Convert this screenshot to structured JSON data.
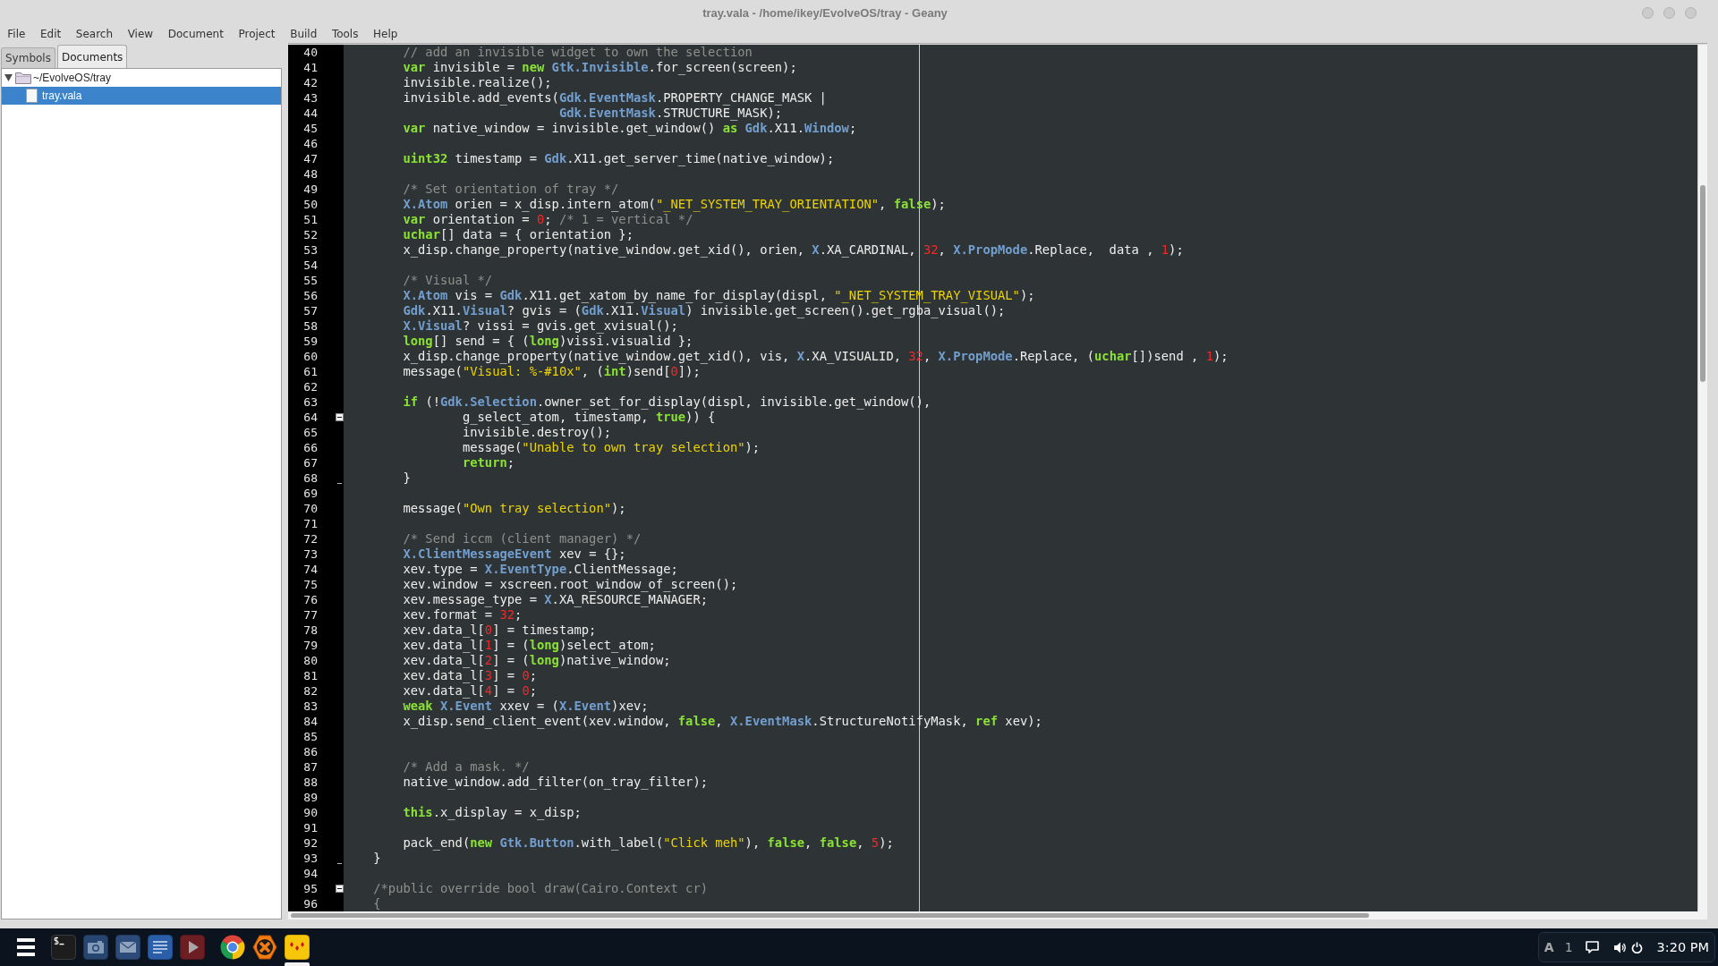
{
  "window": {
    "title": "tray.vala - /home/ikey/EvolveOS/tray - Geany"
  },
  "menu_bar": [
    "File",
    "Edit",
    "Search",
    "View",
    "Document",
    "Project",
    "Build",
    "Tools",
    "Help"
  ],
  "sidebar": {
    "tabs": [
      {
        "label": "Symbols",
        "selected": false
      },
      {
        "label": "Documents",
        "selected": true
      }
    ],
    "tree": [
      {
        "label": "~/EvolveOS/tray",
        "expanded": true,
        "selected": false,
        "children": [
          {
            "label": "tray.vala",
            "selected": true
          }
        ]
      }
    ]
  },
  "editor": {
    "lines": [
      {
        "number": "40",
        "kind": "normal",
        "tokens": [
          {
            "kind": "comment",
            "text": "        // add an invisible widget to own the selection"
          }
        ]
      },
      {
        "number": "41",
        "kind": "normal",
        "tokens": [
          {
            "kind": "keyword",
            "text": "        var"
          },
          {
            "kind": "plain",
            "text": " invisible = "
          },
          {
            "kind": "keyword",
            "text": "new "
          },
          {
            "kind": "type",
            "text": "Gtk.Invisible"
          },
          {
            "kind": "plain",
            "text": ".for_screen(screen);"
          }
        ]
      },
      {
        "number": "42",
        "kind": "normal",
        "tokens": [
          {
            "kind": "plain",
            "text": "        invisible.realize();"
          }
        ]
      },
      {
        "number": "43",
        "kind": "normal",
        "tokens": [
          {
            "kind": "plain",
            "text": "        invisible.add_events("
          },
          {
            "kind": "type",
            "text": "Gdk.EventMask"
          },
          {
            "kind": "plain",
            "text": ".PROPERTY_CHANGE_MASK |"
          }
        ]
      },
      {
        "number": "44",
        "kind": "normal",
        "tokens": [
          {
            "kind": "type",
            "text": "                             Gdk.EventMask"
          },
          {
            "kind": "plain",
            "text": ".STRUCTURE_MASK);"
          }
        ]
      },
      {
        "number": "45",
        "kind": "normal",
        "tokens": [
          {
            "kind": "keyword",
            "text": "        var"
          },
          {
            "kind": "plain",
            "text": " native_window = invisible.get_window() "
          },
          {
            "kind": "keyword",
            "text": "as "
          },
          {
            "kind": "type",
            "text": "Gdk"
          },
          {
            "kind": "plain",
            "text": ".X11."
          },
          {
            "kind": "type",
            "text": "Window"
          },
          {
            "kind": "plain",
            "text": ";"
          }
        ]
      },
      {
        "number": "46",
        "kind": "normal"
      },
      {
        "number": "47",
        "kind": "normal",
        "tokens": [
          {
            "kind": "keyword",
            "text": "        uint32"
          },
          {
            "kind": "plain",
            "text": " timestamp = "
          },
          {
            "kind": "type",
            "text": "Gdk"
          },
          {
            "kind": "plain",
            "text": ".X11.get_server_time(native_window);"
          }
        ]
      },
      {
        "number": "48",
        "kind": "normal"
      },
      {
        "number": "49",
        "kind": "normal",
        "tokens": [
          {
            "kind": "comment",
            "text": "        /* Set orientation of tray */"
          }
        ]
      },
      {
        "number": "50",
        "kind": "normal",
        "tokens": [
          {
            "kind": "type",
            "text": "        X.Atom"
          },
          {
            "kind": "plain",
            "text": " orien = x_disp.intern_atom("
          },
          {
            "kind": "string",
            "text": "\"_NET_SYSTEM_TRAY_ORIENTATION\""
          },
          {
            "kind": "plain",
            "text": ", "
          },
          {
            "kind": "keyword",
            "text": "false"
          },
          {
            "kind": "plain",
            "text": ");"
          }
        ]
      },
      {
        "number": "51",
        "kind": "normal",
        "tokens": [
          {
            "kind": "keyword",
            "text": "        var"
          },
          {
            "kind": "plain",
            "text": " orientation = "
          },
          {
            "kind": "number",
            "text": "0"
          },
          {
            "kind": "plain",
            "text": "; "
          },
          {
            "kind": "comment",
            "text": "/* 1 = vertical */"
          }
        ]
      },
      {
        "number": "52",
        "kind": "normal",
        "tokens": [
          {
            "kind": "keyword",
            "text": "        uchar"
          },
          {
            "kind": "plain",
            "text": "[] data = { orientation };"
          }
        ]
      },
      {
        "number": "53",
        "kind": "normal",
        "tokens": [
          {
            "kind": "plain",
            "text": "        x_disp.change_property(native_window.get_xid(), orien, "
          },
          {
            "kind": "type",
            "text": "X"
          },
          {
            "kind": "plain",
            "text": ".XA_CARDINAL, "
          },
          {
            "kind": "number",
            "text": "32"
          },
          {
            "kind": "plain",
            "text": ", "
          },
          {
            "kind": "type",
            "text": "X.PropMode"
          },
          {
            "kind": "plain",
            "text": ".Replace,  data , "
          },
          {
            "kind": "number",
            "text": "1"
          },
          {
            "kind": "plain",
            "text": ");"
          }
        ]
      },
      {
        "number": "54",
        "kind": "normal"
      },
      {
        "number": "55",
        "kind": "normal",
        "tokens": [
          {
            "kind": "comment",
            "text": "        /* Visual */"
          }
        ]
      },
      {
        "number": "56",
        "kind": "normal",
        "tokens": [
          {
            "kind": "type",
            "text": "        X.Atom"
          },
          {
            "kind": "plain",
            "text": " vis = "
          },
          {
            "kind": "type",
            "text": "Gdk"
          },
          {
            "kind": "plain",
            "text": ".X11.get_xatom_by_name_for_display(displ, "
          },
          {
            "kind": "string",
            "text": "\"_NET_SYSTEM_TRAY_VISUAL\""
          },
          {
            "kind": "plain",
            "text": ");"
          }
        ]
      },
      {
        "number": "57",
        "kind": "normal",
        "tokens": [
          {
            "kind": "type",
            "text": "        Gdk"
          },
          {
            "kind": "plain",
            "text": ".X11."
          },
          {
            "kind": "type",
            "text": "Visual"
          },
          {
            "kind": "plain",
            "text": "? gvis = ("
          },
          {
            "kind": "type",
            "text": "Gdk"
          },
          {
            "kind": "plain",
            "text": ".X11."
          },
          {
            "kind": "type",
            "text": "Visual"
          },
          {
            "kind": "plain",
            "text": ") invisible.get_screen().get_rgba_visual();"
          }
        ]
      },
      {
        "number": "58",
        "kind": "normal",
        "tokens": [
          {
            "kind": "type",
            "text": "        X.Visual"
          },
          {
            "kind": "plain",
            "text": "? vissi = gvis.get_xvisual();"
          }
        ]
      },
      {
        "number": "59",
        "kind": "normal",
        "tokens": [
          {
            "kind": "keyword",
            "text": "        long"
          },
          {
            "kind": "plain",
            "text": "[] send = { ("
          },
          {
            "kind": "keyword",
            "text": "long"
          },
          {
            "kind": "plain",
            "text": ")vissi.visualid };"
          }
        ]
      },
      {
        "number": "60",
        "kind": "normal",
        "tokens": [
          {
            "kind": "plain",
            "text": "        x_disp.change_property(native_window.get_xid(), vis, "
          },
          {
            "kind": "type",
            "text": "X"
          },
          {
            "kind": "plain",
            "text": ".XA_VISUALID, "
          },
          {
            "kind": "number",
            "text": "32"
          },
          {
            "kind": "plain",
            "text": ", "
          },
          {
            "kind": "type",
            "text": "X.PropMode"
          },
          {
            "kind": "plain",
            "text": ".Replace, ("
          },
          {
            "kind": "keyword",
            "text": "uchar"
          },
          {
            "kind": "plain",
            "text": "[])send , "
          },
          {
            "kind": "number",
            "text": "1"
          },
          {
            "kind": "plain",
            "text": ");"
          }
        ]
      },
      {
        "number": "61",
        "kind": "normal",
        "tokens": [
          {
            "kind": "plain",
            "text": "        message("
          },
          {
            "kind": "string",
            "text": "\"Visual: %-#10x\""
          },
          {
            "kind": "plain",
            "text": ", ("
          },
          {
            "kind": "keyword",
            "text": "int"
          },
          {
            "kind": "plain",
            "text": ")send["
          },
          {
            "kind": "number",
            "text": "0"
          },
          {
            "kind": "plain",
            "text": "]);"
          }
        ]
      },
      {
        "number": "62",
        "kind": "normal"
      },
      {
        "number": "63",
        "kind": "normal",
        "tokens": [
          {
            "kind": "keyword",
            "text": "        if"
          },
          {
            "kind": "plain",
            "text": " (!"
          },
          {
            "kind": "type",
            "text": "Gdk.Selection"
          },
          {
            "kind": "plain",
            "text": ".owner_set_for_display(displ, invisible.get_window(),"
          }
        ]
      },
      {
        "number": "64",
        "kind": "foldhead",
        "tokens": [
          {
            "kind": "plain",
            "text": "                g_select_atom, timestamp, "
          },
          {
            "kind": "keyword",
            "text": "true"
          },
          {
            "kind": "plain",
            "text": ")) {"
          }
        ]
      },
      {
        "number": "65",
        "kind": "normal",
        "tokens": [
          {
            "kind": "plain",
            "text": "                invisible.destroy();"
          }
        ]
      },
      {
        "number": "66",
        "kind": "normal",
        "tokens": [
          {
            "kind": "plain",
            "text": "                message("
          },
          {
            "kind": "string",
            "text": "\"Unable to own tray selection\""
          },
          {
            "kind": "plain",
            "text": ");"
          }
        ]
      },
      {
        "number": "67",
        "kind": "normal",
        "tokens": [
          {
            "kind": "keyword",
            "text": "                return"
          },
          {
            "kind": "plain",
            "text": ";"
          }
        ]
      },
      {
        "number": "68",
        "kind": "foldend",
        "tokens": [
          {
            "kind": "plain",
            "text": "        }"
          }
        ]
      },
      {
        "number": "69",
        "kind": "normal"
      },
      {
        "number": "70",
        "kind": "normal",
        "tokens": [
          {
            "kind": "plain",
            "text": "        message("
          },
          {
            "kind": "string",
            "text": "\"Own tray selection\""
          },
          {
            "kind": "plain",
            "text": ");"
          }
        ]
      },
      {
        "number": "71",
        "kind": "normal"
      },
      {
        "number": "72",
        "kind": "normal",
        "tokens": [
          {
            "kind": "comment",
            "text": "        /* Send iccm (client manager) */"
          }
        ]
      },
      {
        "number": "73",
        "kind": "normal",
        "tokens": [
          {
            "kind": "type",
            "text": "        X.ClientMessageEvent"
          },
          {
            "kind": "plain",
            "text": " xev = {};"
          }
        ]
      },
      {
        "number": "74",
        "kind": "normal",
        "tokens": [
          {
            "kind": "plain",
            "text": "        xev.type = "
          },
          {
            "kind": "type",
            "text": "X.EventType"
          },
          {
            "kind": "plain",
            "text": ".ClientMessage;"
          }
        ]
      },
      {
        "number": "75",
        "kind": "normal",
        "tokens": [
          {
            "kind": "plain",
            "text": "        xev.window = xscreen.root_window_of_screen();"
          }
        ]
      },
      {
        "number": "76",
        "kind": "normal",
        "tokens": [
          {
            "kind": "plain",
            "text": "        xev.message_type = "
          },
          {
            "kind": "type",
            "text": "X"
          },
          {
            "kind": "plain",
            "text": ".XA_RESOURCE_MANAGER;"
          }
        ]
      },
      {
        "number": "77",
        "kind": "normal",
        "tokens": [
          {
            "kind": "plain",
            "text": "        xev.format = "
          },
          {
            "kind": "number",
            "text": "32"
          },
          {
            "kind": "plain",
            "text": ";"
          }
        ]
      },
      {
        "number": "78",
        "kind": "normal",
        "tokens": [
          {
            "kind": "plain",
            "text": "        xev.data_l["
          },
          {
            "kind": "number",
            "text": "0"
          },
          {
            "kind": "plain",
            "text": "] = timestamp;"
          }
        ]
      },
      {
        "number": "79",
        "kind": "normal",
        "tokens": [
          {
            "kind": "plain",
            "text": "        xev.data_l["
          },
          {
            "kind": "number",
            "text": "1"
          },
          {
            "kind": "plain",
            "text": "] = ("
          },
          {
            "kind": "keyword",
            "text": "long"
          },
          {
            "kind": "plain",
            "text": ")select_atom;"
          }
        ]
      },
      {
        "number": "80",
        "kind": "normal",
        "tokens": [
          {
            "kind": "plain",
            "text": "        xev.data_l["
          },
          {
            "kind": "number",
            "text": "2"
          },
          {
            "kind": "plain",
            "text": "] = ("
          },
          {
            "kind": "keyword",
            "text": "long"
          },
          {
            "kind": "plain",
            "text": ")native_window;"
          }
        ]
      },
      {
        "number": "81",
        "kind": "normal",
        "tokens": [
          {
            "kind": "plain",
            "text": "        xev.data_l["
          },
          {
            "kind": "number",
            "text": "3"
          },
          {
            "kind": "plain",
            "text": "] = "
          },
          {
            "kind": "number",
            "text": "0"
          },
          {
            "kind": "plain",
            "text": ";"
          }
        ]
      },
      {
        "number": "82",
        "kind": "normal",
        "tokens": [
          {
            "kind": "plain",
            "text": "        xev.data_l["
          },
          {
            "kind": "number",
            "text": "4"
          },
          {
            "kind": "plain",
            "text": "] = "
          },
          {
            "kind": "number",
            "text": "0"
          },
          {
            "kind": "plain",
            "text": ";"
          }
        ]
      },
      {
        "number": "83",
        "kind": "normal",
        "tokens": [
          {
            "kind": "keyword",
            "text": "        weak "
          },
          {
            "kind": "type",
            "text": "X.Event"
          },
          {
            "kind": "plain",
            "text": " xxev = ("
          },
          {
            "kind": "type",
            "text": "X.Event"
          },
          {
            "kind": "plain",
            "text": ")xev;"
          }
        ]
      },
      {
        "number": "84",
        "kind": "normal",
        "tokens": [
          {
            "kind": "plain",
            "text": "        x_disp.send_client_event(xev.window, "
          },
          {
            "kind": "keyword",
            "text": "false"
          },
          {
            "kind": "plain",
            "text": ", "
          },
          {
            "kind": "type",
            "text": "X.EventMask"
          },
          {
            "kind": "plain",
            "text": ".StructureNotifyMask, "
          },
          {
            "kind": "keyword",
            "text": "ref"
          },
          {
            "kind": "plain",
            "text": " xev);"
          }
        ]
      },
      {
        "number": "85",
        "kind": "normal"
      },
      {
        "number": "86",
        "kind": "normal"
      },
      {
        "number": "87",
        "kind": "normal",
        "tokens": [
          {
            "kind": "comment",
            "text": "        /* Add a mask. */"
          }
        ]
      },
      {
        "number": "88",
        "kind": "normal",
        "tokens": [
          {
            "kind": "plain",
            "text": "        native_window.add_filter(on_tray_filter);"
          }
        ]
      },
      {
        "number": "89",
        "kind": "normal"
      },
      {
        "number": "90",
        "kind": "normal",
        "tokens": [
          {
            "kind": "keyword",
            "text": "        this"
          },
          {
            "kind": "plain",
            "text": ".x_display = x_disp;"
          }
        ]
      },
      {
        "number": "91",
        "kind": "normal"
      },
      {
        "number": "92",
        "kind": "normal",
        "tokens": [
          {
            "kind": "plain",
            "text": "        pack_end("
          },
          {
            "kind": "keyword",
            "text": "new "
          },
          {
            "kind": "type",
            "text": "Gtk.Button"
          },
          {
            "kind": "plain",
            "text": ".with_label("
          },
          {
            "kind": "string",
            "text": "\"Click meh\""
          },
          {
            "kind": "plain",
            "text": "), "
          },
          {
            "kind": "keyword",
            "text": "false"
          },
          {
            "kind": "plain",
            "text": ", "
          },
          {
            "kind": "keyword",
            "text": "false"
          },
          {
            "kind": "plain",
            "text": ", "
          },
          {
            "kind": "number",
            "text": "5"
          },
          {
            "kind": "plain",
            "text": ");"
          }
        ]
      },
      {
        "number": "93",
        "kind": "foldend",
        "tokens": [
          {
            "kind": "plain",
            "text": "    }"
          }
        ]
      },
      {
        "number": "94",
        "kind": "normal"
      },
      {
        "number": "95",
        "kind": "foldhead",
        "tokens": [
          {
            "kind": "comment",
            "text": "    /*public override bool draw(Cairo.Context cr)"
          }
        ]
      },
      {
        "number": "96",
        "kind": "normal",
        "tokens": [
          {
            "kind": "comment",
            "text": "    {"
          }
        ]
      }
    ]
  },
  "taskbar": {
    "launchers": [
      {
        "active": false
      },
      {
        "active": false
      },
      {
        "active": false
      },
      {
        "active": false
      },
      {
        "active": false
      },
      {
        "active": false
      },
      {
        "active": false
      },
      {
        "active": true
      }
    ],
    "tray_labels": [
      "A",
      "1"
    ],
    "clock": "3:20 PM"
  }
}
